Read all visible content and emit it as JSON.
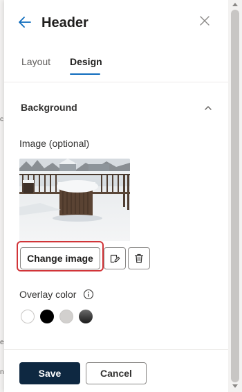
{
  "panel": {
    "title": "Header",
    "back_icon": "arrow-left-icon",
    "close_icon": "close-icon"
  },
  "tabs": [
    {
      "label": "Layout",
      "selected": false
    },
    {
      "label": "Design",
      "selected": true
    }
  ],
  "background_section": {
    "title": "Background",
    "expanded": true,
    "image_label": "Image (optional)",
    "change_image_label": "Change image",
    "edit_icon": "edit-icon",
    "delete_icon": "trash-icon",
    "overlay_label": "Overlay color",
    "info_icon": "info-icon",
    "overlay_colors": [
      "#ffffff",
      "#000000",
      "#d2d0ce",
      "#333333"
    ]
  },
  "footer": {
    "save_label": "Save",
    "cancel_label": "Cancel"
  },
  "backdrop_fragments": [
    "c",
    "e",
    "n"
  ],
  "colors": {
    "accent": "#0f6cbd",
    "primary_button": "#0e2841",
    "highlight": "#d13438"
  }
}
